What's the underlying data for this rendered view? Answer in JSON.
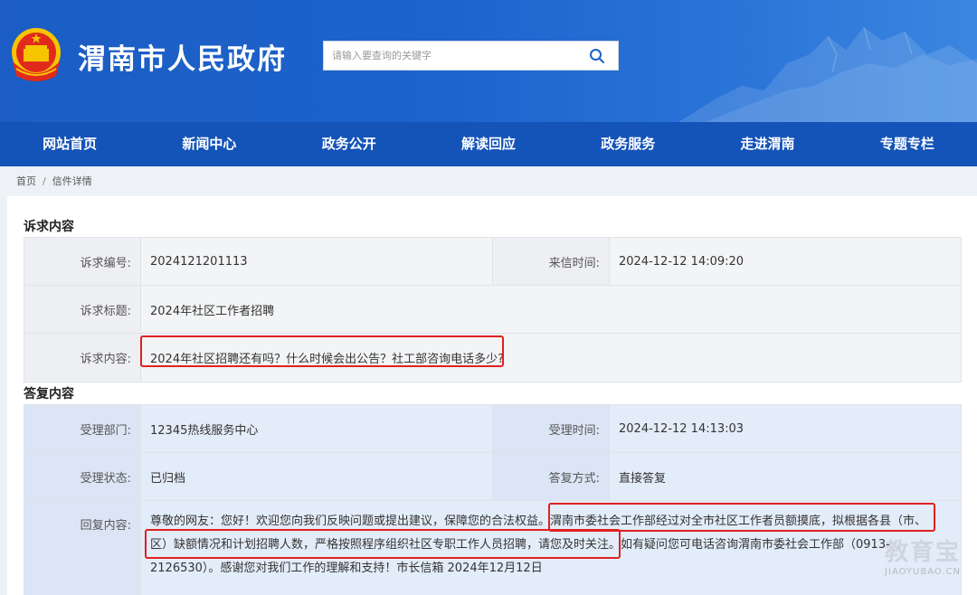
{
  "header": {
    "site_title": "渭南市人民政府",
    "search_placeholder": "请输入要查询的关键字"
  },
  "nav": [
    "网站首页",
    "新闻中心",
    "政务公开",
    "解读回应",
    "政务服务",
    "走进渭南",
    "专题专栏"
  ],
  "breadcrumb": {
    "home": "首页",
    "separator": "/",
    "current": "信件详情"
  },
  "appeal": {
    "section_title": "诉求内容",
    "number_label": "诉求编号:",
    "number_value": "2024121201113",
    "time_label": "来信时间:",
    "time_value": "2024-12-12 14:09:20",
    "title_label": "诉求标题:",
    "title_value": "2024年社区工作者招聘",
    "content_label": "诉求内容:",
    "content_value": "2024年社区招聘还有吗？什么时候会出公告？社工部咨询电话多少?"
  },
  "reply": {
    "section_title": "答复内容",
    "dept_label": "受理部门:",
    "dept_value": "12345热线服务中心",
    "time_label": "受理时间:",
    "time_value": "2024-12-12 14:13:03",
    "status_label": "受理状态:",
    "status_value": "已归档",
    "method_label": "答复方式:",
    "method_value": "直接答复",
    "content_label": "回复内容:",
    "content_line1": "尊敬的网友：您好！欢迎您向我们反映问题或提出建议，保障您的合法权益。渭南市委社会工作部经过对全市社区工作者员额摸底，拟根据各县（市、",
    "content_line2": "区）缺额情况和计划招聘人数，严格按照程序组织社区专职工作人员招聘，请您及时关注。如有疑问您可电话咨询渭南市委社会工作部（0913-",
    "content_line3": "2126530）。感谢您对我们工作的理解和支持！市长信箱 2024年12月12日"
  },
  "watermark": {
    "brand": "教育宝",
    "url": "JIAOYUBAO.CN"
  },
  "colors": {
    "header_blue": "#1d63cc",
    "nav_blue": "#1453b8",
    "highlight_red": "#e02020"
  }
}
